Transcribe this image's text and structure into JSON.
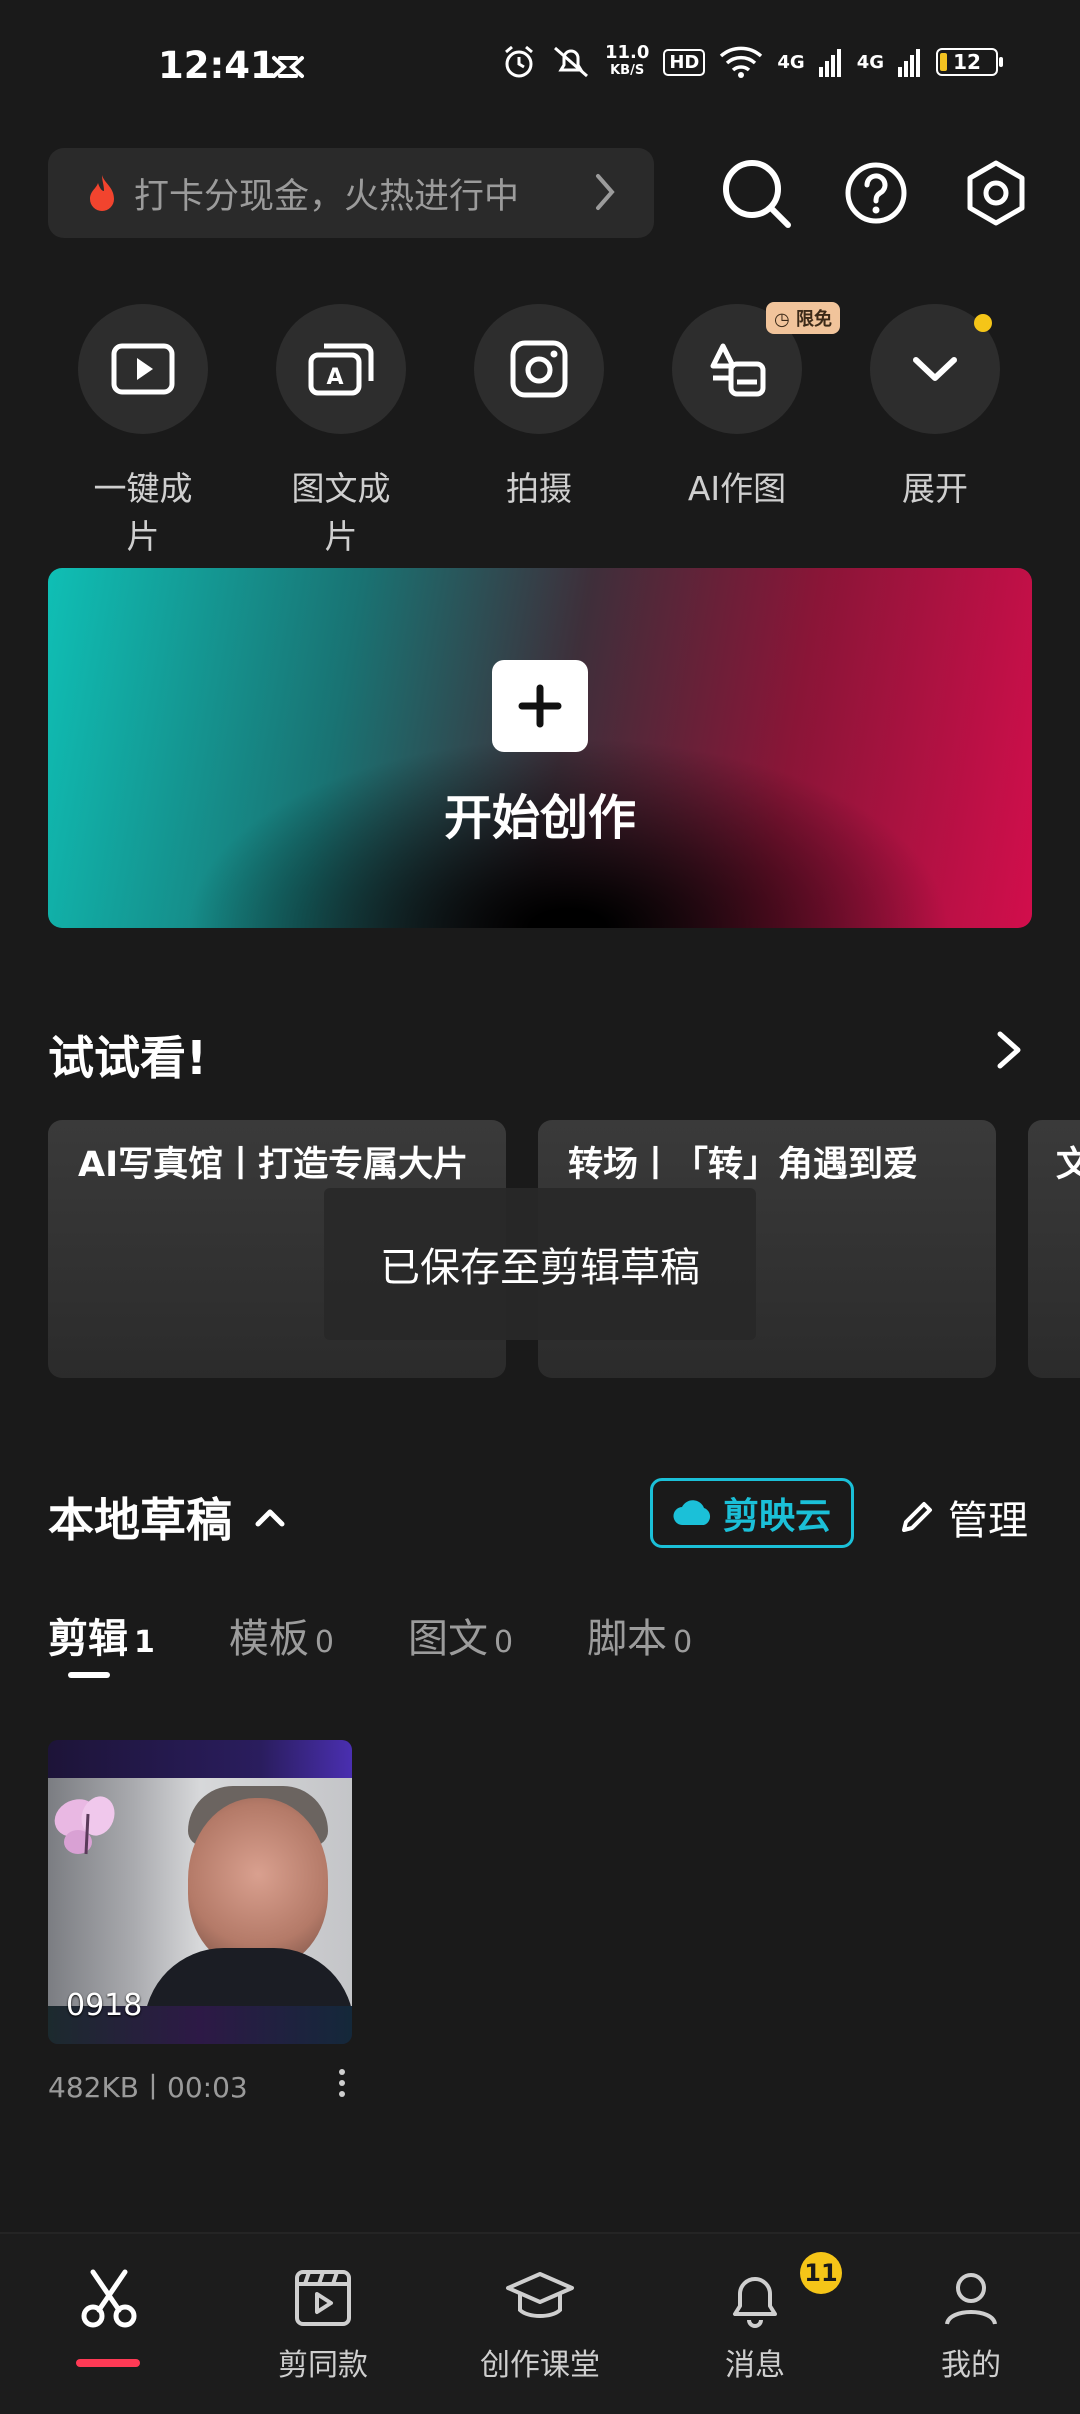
{
  "status_bar": {
    "time": "12:41",
    "net_speed_value": "11.0",
    "net_speed_unit": "KB/S",
    "hd_label": "HD",
    "signal1_label": "4G",
    "signal2_label": "4G",
    "battery": "12"
  },
  "promo": {
    "text": "打卡分现金，火热进行中"
  },
  "quick_actions": [
    {
      "label": "一键成片",
      "icon": "play-icon"
    },
    {
      "label": "图文成片",
      "icon": "text-to-video-icon"
    },
    {
      "label": "拍摄",
      "icon": "camera-icon"
    },
    {
      "label": "AI作图",
      "icon": "ai-image-icon",
      "badge": "限免"
    },
    {
      "label": "展开",
      "icon": "chevron-down-icon"
    }
  ],
  "banner": {
    "title": "开始创作"
  },
  "try_section": {
    "title": "试试看!",
    "cards": [
      {
        "title": "AI写真馆丨打造专属大片"
      },
      {
        "title": "转场丨「转」角遇到爱"
      },
      {
        "title": "文"
      }
    ]
  },
  "toast": "已保存至剪辑草稿",
  "drafts": {
    "title": "本地草稿",
    "cloud_label": "剪映云",
    "manage_label": "管理",
    "tabs": [
      {
        "label": "剪辑",
        "count": "1"
      },
      {
        "label": "模板",
        "count": "0"
      },
      {
        "label": "图文",
        "count": "0"
      },
      {
        "label": "脚本",
        "count": "0"
      }
    ],
    "items": [
      {
        "name": "0918",
        "meta": "482KB丨00:03"
      }
    ]
  },
  "bottom_nav": {
    "items": [
      {
        "label": ""
      },
      {
        "label": "剪同款"
      },
      {
        "label": "创作课堂"
      },
      {
        "label": "消息",
        "badge": "11"
      },
      {
        "label": "我的"
      }
    ]
  },
  "colors": {
    "background": "#1a1a1a",
    "accent_cyan": "#1bc0d8",
    "accent_red": "#ff3a55",
    "badge_yellow": "#f5c518"
  }
}
